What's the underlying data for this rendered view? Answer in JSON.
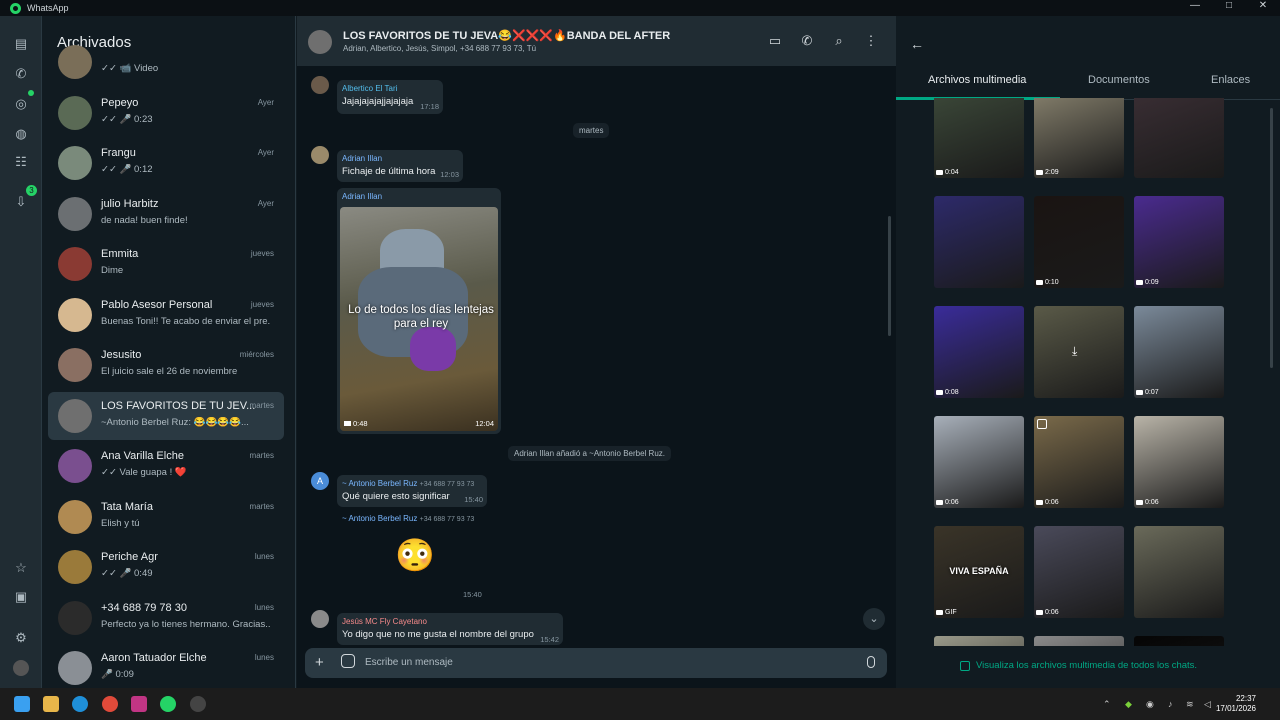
{
  "window": {
    "title": "WhatsApp",
    "controls": [
      "—",
      "□",
      "✕"
    ]
  },
  "rail": {
    "archive_badge": "3"
  },
  "chatlist": {
    "title": "Archivados",
    "items": [
      {
        "name": "",
        "preview": "✓✓ 📹 Video",
        "time": "",
        "avatar_color": "#7a6e58"
      },
      {
        "name": "Pepeyo",
        "preview": "✓✓ 🎤 0:23",
        "time": "Ayer",
        "avatar_color": "#5a6a55"
      },
      {
        "name": "Frangu",
        "preview": "✓✓ 🎤 0:12",
        "time": "Ayer",
        "avatar_color": "#7a8a7b"
      },
      {
        "name": "julio Harbitz",
        "preview": "de nada! buen finde!",
        "time": "Ayer",
        "avatar_color": "#6b6f72"
      },
      {
        "name": "Emmita",
        "preview": "Dime",
        "time": "jueves",
        "avatar_color": "#8a3a33"
      },
      {
        "name": "Pablo Asesor Personal",
        "preview": "Buenas Toni!! Te acabo de enviar el pre...",
        "time": "jueves",
        "avatar_color": "#d6b890"
      },
      {
        "name": "Jesusito",
        "preview": "El juicio sale el 26 de noviembre",
        "time": "miércoles",
        "avatar_color": "#8a6f62"
      },
      {
        "name": "LOS FAVORITOS DE TU JEV...",
        "preview": "~Antonio Berbel Ruz: 😂😂😂😂...",
        "time": "martes",
        "avatar_color": "#6f6f6f"
      },
      {
        "name": "Ana Varilla Elche",
        "preview": "✓✓ Vale guapa ! ❤️",
        "time": "martes",
        "avatar_color": "#7a4f8f"
      },
      {
        "name": "Tata María",
        "preview": "Elish y tú",
        "time": "martes",
        "avatar_color": "#b08a52"
      },
      {
        "name": "Periche Agr",
        "preview": "✓✓ 🎤 0:49",
        "time": "lunes",
        "avatar_color": "#9a7a3a"
      },
      {
        "name": "+34 688 79 78 30",
        "preview": "Perfecto ya lo tienes hermano. Gracias...",
        "time": "lunes",
        "avatar_color": "#2b2b2b"
      },
      {
        "name": "Aaron Tatuador Elche",
        "preview": "🎤 0:09",
        "time": "lunes",
        "avatar_color": "#8a8f95"
      }
    ]
  },
  "conversation": {
    "group_name": "LOS FAVORITOS DE TU JEVA😂❌❌❌🔥BANDA DEL AFTER",
    "members": "Adrian, Albertico, Jesús, Simpol, +34 688 77 93 73, Tú",
    "messages": {
      "m1": {
        "sender": "Albertico El Tari",
        "text": "Jajajajajajjajajaja",
        "time": "17:18"
      },
      "date1": "martes",
      "m2": {
        "sender": "Adrian Illan",
        "text": "Fichaje de última hora",
        "time": "12:03"
      },
      "m3": {
        "sender": "Adrian Illan",
        "video_caption": "Lo de todos los días lentejas para el rey",
        "duration": "0:48",
        "time": "12:04"
      },
      "sys1": "Adrian Illan añadió a ~Antonio Berbel Ruz.",
      "m4": {
        "sender": "~ Antonio Berbel Ruz",
        "phone": "+34 688 77 93 73",
        "text": "Qué quiere esto significar",
        "time": "15:40"
      },
      "m5": {
        "sender": "~ Antonio Berbel Ruz",
        "phone": "+34 688 77 93 73",
        "emoji": "😳",
        "time": "15:40"
      },
      "m6": {
        "sender": "Jesús MC Fly Cayetano",
        "text": "Yo digo que no me gusta el nombre del grupo",
        "time": "15:42"
      }
    },
    "composer": {
      "placeholder": "Escribe un mensaje"
    }
  },
  "media_panel": {
    "tabs": [
      "Archivos multimedia",
      "Documentos",
      "Enlaces"
    ],
    "active_tab": "Archivos multimedia",
    "thumbs": [
      {
        "dur": "0:04",
        "color": "#3d4a3a"
      },
      {
        "dur": "2:09",
        "color": "#8a8470"
      },
      {
        "dur": "",
        "color": "#3b2f35"
      },
      {
        "dur": "",
        "color": "#2d2a6a"
      },
      {
        "dur": "0:10",
        "color": "#1a1412"
      },
      {
        "dur": "0:09",
        "color": "#4a2b8f"
      },
      {
        "dur": "0:08",
        "color": "#3a2c9a"
      },
      {
        "dur": "",
        "color": "#5a5a48"
      },
      {
        "dur": "0:07",
        "color": "#7b8a9a"
      },
      {
        "dur": "0:06",
        "color": "#a8b0ba"
      },
      {
        "dur": "0:06",
        "color": "#7a6a4a"
      },
      {
        "dur": "0:06",
        "color": "#b9b4a8"
      },
      {
        "dur": "GIF",
        "color": "#3a3428",
        "label": "VIVA ESPAÑA"
      },
      {
        "dur": "0:06",
        "color": "#4a4a5a"
      },
      {
        "dur": "",
        "color": "#6a6a5a"
      },
      {
        "dur": "",
        "color": "#9a9a8a"
      },
      {
        "dur": "",
        "color": "#8a8a8a"
      },
      {
        "dur": "",
        "color": "#050505"
      }
    ],
    "footer_link": "Visualiza los archivos multimedia de todos los chats."
  },
  "taskbar": {
    "time": "22:37",
    "date": "17/01/2026"
  }
}
